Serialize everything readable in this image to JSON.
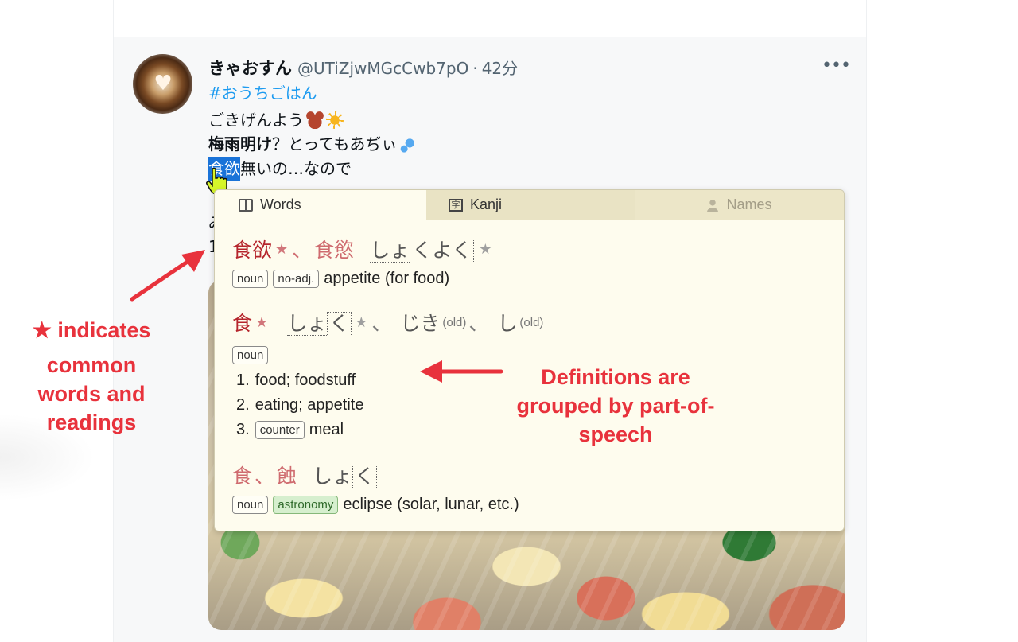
{
  "tweet": {
    "author_name": "きゃおすん",
    "handle": "@UTiZjwMGcCwb7pO",
    "separator": "·",
    "time": "42分",
    "more": "•••",
    "hashtag": "#おうちごはん",
    "line2": "ごきげんよう",
    "line3_bold": "梅雨明け",
    "line3_rest": "？とってもあぢぃ",
    "line4_selected": "食欲",
    "line4_rest": "無いの…なので",
    "line6_start": "み",
    "line7_start": "1"
  },
  "popup": {
    "tabs": [
      {
        "label": "Words",
        "icon": "book-icon",
        "active": true
      },
      {
        "label": "Kanji",
        "icon": "kanji-icon",
        "active": false
      },
      {
        "label": "Names",
        "icon": "person-icon",
        "active": false,
        "disabled": true
      }
    ],
    "entries": [
      {
        "kanji": [
          "食欲",
          "食慾"
        ],
        "kanji_common": [
          true,
          false
        ],
        "kana_prefix": "しょ",
        "kana_boxed": "くよく",
        "kana_common": true,
        "tags": [
          "noun",
          "no-adj."
        ],
        "gloss": "appetite (for food)"
      },
      {
        "kanji": [
          "食"
        ],
        "kanji_common": [
          true
        ],
        "readings": [
          {
            "prefix": "しょ",
            "boxed": "く",
            "common": true
          },
          {
            "text": "じき",
            "note": "(old)"
          },
          {
            "text": "し",
            "note": "(old)"
          }
        ],
        "tags": [
          "noun"
        ],
        "senses": [
          {
            "num": "1.",
            "text": "food; foodstuff"
          },
          {
            "num": "2.",
            "text": "eating; appetite"
          },
          {
            "num": "3.",
            "tag": "counter",
            "text": "meal"
          }
        ]
      },
      {
        "kanji": [
          "食",
          "蝕"
        ],
        "kana_prefix": "しょ",
        "kana_boxed": "く",
        "tags": [
          "noun",
          "astronomy"
        ],
        "gloss": "eclipse (solar, lunar, etc.)"
      }
    ],
    "separator_comma": "、",
    "star": "★"
  },
  "annotations": {
    "left_star": "★",
    "left_line1": "indicates",
    "left_line2": "common",
    "left_line3": "words and",
    "left_line4": "readings",
    "right_line1": "Definitions are",
    "right_line2": "grouped by part-of-",
    "right_line3": "speech",
    "color": "#e8323c"
  },
  "colors": {
    "kanji": "#b5252c",
    "kanji_secondary": "#cf6b6f",
    "popup_bg": "#fefcee",
    "tab_bar": "#ece6c8",
    "selection": "#1a73d8",
    "hashtag": "#1d9bf0"
  }
}
